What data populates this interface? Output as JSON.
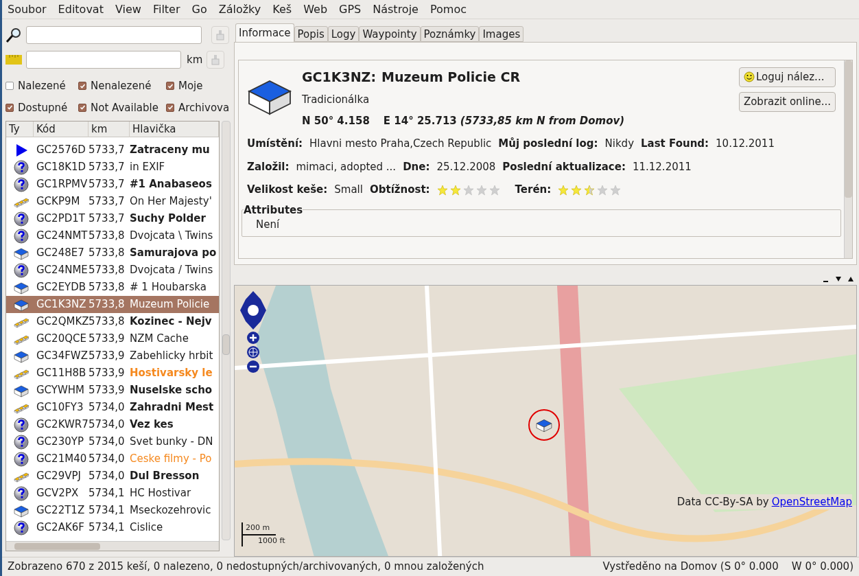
{
  "menu": [
    "Soubor",
    "Editovat",
    "View",
    "Filter",
    "Go",
    "Záložky",
    "Keš",
    "Web",
    "GPS",
    "Nástroje",
    "Pomoc"
  ],
  "search": {
    "unit": "km"
  },
  "filters": [
    {
      "label": "Nalezené",
      "checked": false
    },
    {
      "label": "Nenalezené",
      "checked": true
    },
    {
      "label": "Moje",
      "checked": true
    },
    {
      "label": "Dostupné",
      "checked": true
    },
    {
      "label": "Not Available",
      "checked": true
    },
    {
      "label": "Archivova",
      "checked": true
    }
  ],
  "table": {
    "columns": [
      "Ty",
      "Kód",
      "km",
      "Hlavička"
    ],
    "rows": [
      {
        "kind": "event",
        "code": "GC2576D",
        "km": "5733,7",
        "title": "Zatraceny mu",
        "bold": true,
        "highlighted": false,
        "selected": false
      },
      {
        "kind": "mystery",
        "code": "GC18K1D",
        "km": "5733,7",
        "title": "in EXIF",
        "bold": false,
        "highlighted": false,
        "selected": false
      },
      {
        "kind": "mystery",
        "code": "GC1RPMV",
        "km": "5733,7",
        "title": "#1 Anabaseos",
        "bold": true,
        "highlighted": false,
        "selected": false
      },
      {
        "kind": "multi",
        "code": "GCKP9M",
        "km": "5733,7",
        "title": "On Her Majesty'",
        "bold": false,
        "highlighted": false,
        "selected": false
      },
      {
        "kind": "mystery",
        "code": "GC2PD1T",
        "km": "5733,7",
        "title": "Suchy Polder",
        "bold": true,
        "highlighted": false,
        "selected": false
      },
      {
        "kind": "mystery",
        "code": "GC24NMT",
        "km": "5733,8",
        "title": "Dvojcata \\ Twins",
        "bold": false,
        "highlighted": false,
        "selected": false
      },
      {
        "kind": "traditional",
        "code": "GC248E7",
        "km": "5733,8",
        "title": "Samurajova po",
        "bold": true,
        "highlighted": false,
        "selected": false
      },
      {
        "kind": "mystery",
        "code": "GC24NME",
        "km": "5733,8",
        "title": "Dvojcata / Twins",
        "bold": false,
        "highlighted": false,
        "selected": false
      },
      {
        "kind": "traditional",
        "code": "GC2EYDB",
        "km": "5733,8",
        "title": "# 1 Houbarska",
        "bold": false,
        "highlighted": false,
        "selected": false
      },
      {
        "kind": "traditional",
        "code": "GC1K3NZ",
        "km": "5733,8",
        "title": "Muzeum Policie",
        "bold": false,
        "highlighted": false,
        "selected": true
      },
      {
        "kind": "multi",
        "code": "GC2QMKZ",
        "km": "5733,8",
        "title": "Kozinec - Nejv",
        "bold": true,
        "highlighted": false,
        "selected": false
      },
      {
        "kind": "multi",
        "code": "GC20QCE",
        "km": "5733,9",
        "title": "NZM Cache",
        "bold": false,
        "highlighted": false,
        "selected": false
      },
      {
        "kind": "traditional",
        "code": "GC34FWZ",
        "km": "5733,9",
        "title": "Zabehlicky hrbit",
        "bold": false,
        "highlighted": false,
        "selected": false
      },
      {
        "kind": "multi",
        "code": "GC11H8B",
        "km": "5733,9",
        "title": "Hostivarsky le",
        "bold": true,
        "highlighted": true,
        "selected": false
      },
      {
        "kind": "traditional",
        "code": "GCYWHM",
        "km": "5733,9",
        "title": "Nuselske scho",
        "bold": true,
        "highlighted": false,
        "selected": false
      },
      {
        "kind": "multi",
        "code": "GC10FY3",
        "km": "5734,0",
        "title": "Zahradni Mest",
        "bold": true,
        "highlighted": false,
        "selected": false
      },
      {
        "kind": "mystery",
        "code": "GC2KWR7",
        "km": "5734,0",
        "title": "Vez kes",
        "bold": true,
        "highlighted": false,
        "selected": false
      },
      {
        "kind": "mystery",
        "code": "GC230YP",
        "km": "5734,0",
        "title": "Svet bunky - DN",
        "bold": false,
        "highlighted": false,
        "selected": false
      },
      {
        "kind": "mystery",
        "code": "GC21M40",
        "km": "5734,0",
        "title": "Ceske filmy - Po",
        "bold": false,
        "highlighted": true,
        "selected": false
      },
      {
        "kind": "multi",
        "code": "GC29VPJ",
        "km": "5734,0",
        "title": "Dul Bresson",
        "bold": true,
        "highlighted": false,
        "selected": false
      },
      {
        "kind": "mystery",
        "code": "GCV2PX",
        "km": "5734,1",
        "title": "HC Hostivar",
        "bold": false,
        "highlighted": false,
        "selected": false
      },
      {
        "kind": "traditional",
        "code": "GC22T1Z",
        "km": "5734,1",
        "title": "Mseckozehrovic",
        "bold": false,
        "highlighted": false,
        "selected": false
      },
      {
        "kind": "mystery",
        "code": "GC2AK6F",
        "km": "5734,1",
        "title": "Cislice",
        "bold": false,
        "highlighted": false,
        "selected": false
      }
    ]
  },
  "tabs": [
    {
      "label": "Informace",
      "selected": true
    },
    {
      "label": "Popis",
      "selected": false
    },
    {
      "label": "Logy",
      "selected": false
    },
    {
      "label": "Waypointy",
      "selected": false
    },
    {
      "label": "Poznámky",
      "selected": false
    },
    {
      "label": "Images",
      "selected": false
    }
  ],
  "cache": {
    "kind": "traditional",
    "code": "GC1K3NZ:",
    "name": "Muzeum Policie CR",
    "type": "Tradicionálka",
    "lat": "N 50° 4.158",
    "lon": "E 14° 25.713",
    "distance": "(5733,85 km N from Domov)",
    "buttons": [
      {
        "label": "Loguj nález..."
      },
      {
        "label": "Zobrazit online..."
      }
    ],
    "lines": [
      [
        {
          "label": "Umístění:",
          "value": "Hlavni mesto Praha,Czech Republic"
        },
        {
          "label": "Můj poslední log:",
          "value": "Nikdy"
        },
        {
          "label": "Last Found:",
          "value": "10.12.2011"
        }
      ],
      [
        {
          "label": "Založil:",
          "value": "mimaci, adopted ..."
        },
        {
          "label": "Dne:",
          "value": "25.12.2008"
        },
        {
          "label": "Poslední aktualizace:",
          "value": "11.12.2011"
        }
      ]
    ],
    "size_label": "Velikost keše:",
    "size": "Small",
    "difficulty_label": "Obtížnost:",
    "difficulty": {
      "stars": 2
    },
    "terrain_label": "Terén:",
    "terrain": {
      "stars": 2.5
    },
    "attributes_title": "Attributes",
    "attributes": "Není"
  },
  "map": {
    "scale_m": "200 m",
    "scale_ft": "1000 ft",
    "attribution": "Data CC-By-SA by",
    "attribution_link": "OpenStreetMap"
  },
  "status": {
    "left": "Zobrazeno 670 z 2015 keší, 0 nalezeno, 0 nedostupných/archivovaných, 0 mnou založených",
    "right": "Vystředěno na Domov (S 0° 0.000    W 0° 0.000)"
  }
}
